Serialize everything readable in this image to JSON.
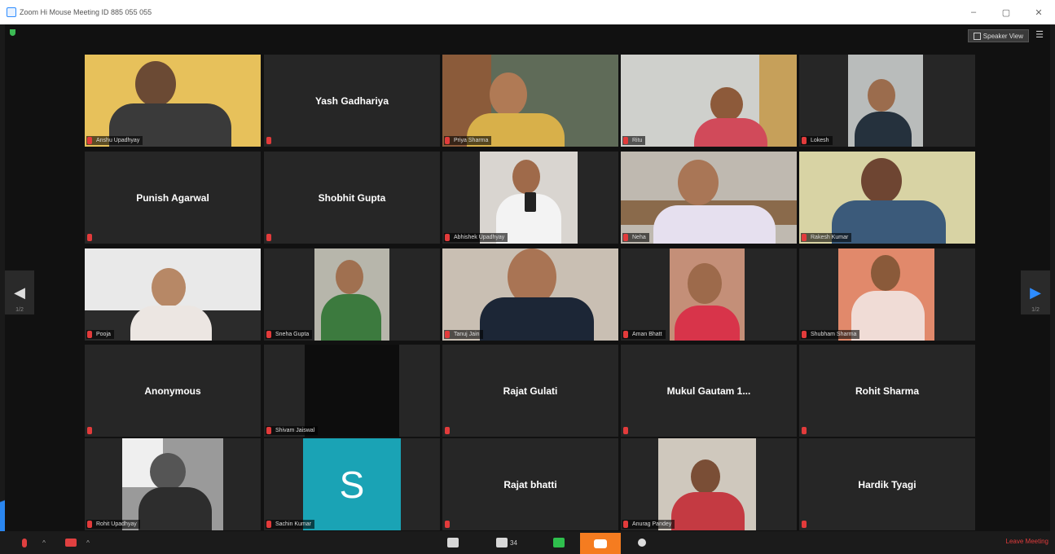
{
  "window": {
    "title": "Zoom Hi Mouse Meeting ID 885 055 055",
    "controls": [
      "–",
      "▢",
      "✕"
    ]
  },
  "header": {
    "view_label": "Speaker View",
    "menu_icon": "menu-icon"
  },
  "navigation": {
    "prev_page": "1/2",
    "next_page": "1/2"
  },
  "participants": [
    {
      "name": "Anshu Upadhyay",
      "video": true
    },
    {
      "name": "Yash Gadhariya",
      "video": false
    },
    {
      "name": "Priya Sharma",
      "video": true
    },
    {
      "name": "Ritu",
      "video": true
    },
    {
      "name": "Lokesh",
      "video": true
    },
    {
      "name": "Punish Agarwal",
      "video": false
    },
    {
      "name": "Shobhit Gupta",
      "video": false
    },
    {
      "name": "Abhishek Upadhyay",
      "video": true
    },
    {
      "name": "Neha",
      "video": true
    },
    {
      "name": "Rakesh Kumar",
      "video": true
    },
    {
      "name": "Pooja",
      "video": true
    },
    {
      "name": "Sneha Gupta",
      "video": true
    },
    {
      "name": "Tanuj Jain",
      "video": true
    },
    {
      "name": "Aman Bhatt",
      "video": true
    },
    {
      "name": "Shubham Sharma",
      "video": true
    },
    {
      "name": "Anonymous",
      "video": false
    },
    {
      "name": "Shivam Jaiswal",
      "video": true
    },
    {
      "name": "Rajat Gulati",
      "video": false
    },
    {
      "name": "Mukul Gautam 1...",
      "video": false
    },
    {
      "name": "Rohit Sharma",
      "video": false
    },
    {
      "name": "Rohit Upadhyay",
      "video": true
    },
    {
      "name": "Sachin Kumar",
      "video": true,
      "avatar_letter": "S"
    },
    {
      "name": "Rajat bhatti",
      "video": false
    },
    {
      "name": "Anurag Pandey",
      "video": true
    },
    {
      "name": "Hardik Tyagi",
      "video": false
    }
  ],
  "toolbar": {
    "leave_label": "Leave Meeting",
    "participants_count": "34"
  },
  "colors": {
    "accent": "#2d8cff",
    "muted": "#e04040",
    "chat": "#f57c20",
    "tile_bg": "#262626"
  }
}
